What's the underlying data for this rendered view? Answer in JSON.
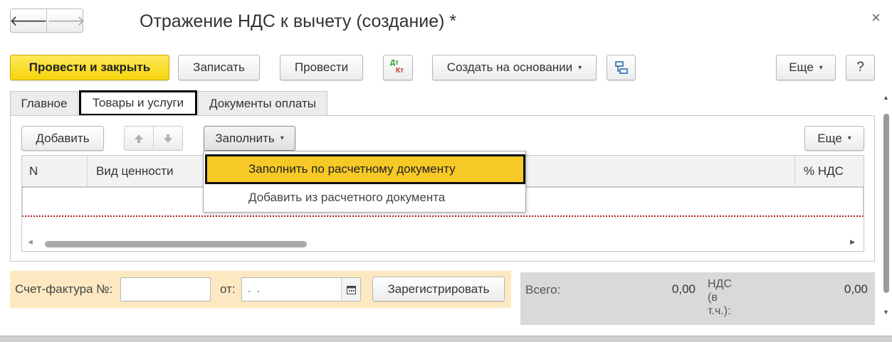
{
  "window": {
    "title": "Отражение НДС к вычету (создание) *",
    "close_glyph": "×"
  },
  "nav": {
    "back_glyph": "🡐",
    "forward_glyph": "🡒"
  },
  "toolbar": {
    "post_close": "Провести и закрыть",
    "save": "Записать",
    "post": "Провести",
    "dt_label": "Дт",
    "kt_label": "Кт",
    "create_based": "Создать на основании",
    "more": "Еще",
    "help": "?"
  },
  "tabs": [
    {
      "label": "Главное"
    },
    {
      "label": "Товары и услуги"
    },
    {
      "label": "Документы оплаты"
    }
  ],
  "table_toolbar": {
    "add": "Добавить",
    "fill": "Заполнить",
    "more": "Еще"
  },
  "fill_menu": {
    "items": [
      "Заполнить по расчетному документу",
      "Добавить из расчетного документа"
    ]
  },
  "table": {
    "columns": [
      "N",
      "Вид ценности",
      "% НДС"
    ]
  },
  "invoice": {
    "label": "Счет-фактура №:",
    "number_value": "",
    "date_label": "от:",
    "date_value": ".  .",
    "register_button": "Зарегистрировать"
  },
  "totals": {
    "total_label": "Всего:",
    "total_value": "0,00",
    "vat_label_1": "НДС",
    "vat_label_2": "(в",
    "vat_label_3": "т.ч.):",
    "vat_value": "0,00"
  },
  "colors": {
    "accent_yellow": "#f5d40c",
    "menu_highlight": "#f7c926",
    "invoice_panel": "#fde9c1",
    "totals_panel": "#d9d9d9",
    "dt_color": "#2e9c2e",
    "kt_color": "#d0302a"
  }
}
